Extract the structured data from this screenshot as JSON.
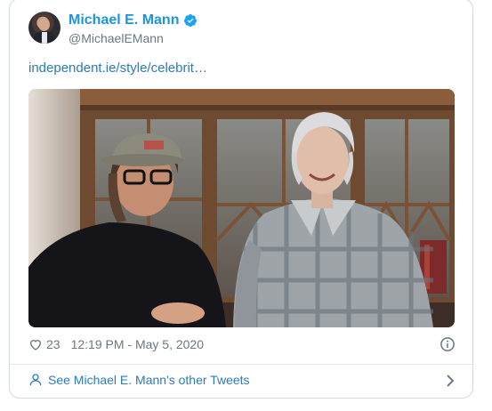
{
  "author": {
    "display_name": "Michael E. Mann",
    "handle": "@MichaelEMann",
    "verified": true
  },
  "tweet": {
    "link_text": "independent.ie/style/celebrit…",
    "likes": "23",
    "timestamp": "12:19 PM - May 5, 2020"
  },
  "footer": {
    "see_more": "See Michael E. Mann's other Tweets"
  },
  "colors": {
    "accent": "#1b95e0",
    "link": "#2b7bb9",
    "muted": "#697882",
    "border": "#cfd9de"
  },
  "icons": {
    "verified": "verified-badge-icon",
    "like": "heart-icon",
    "info": "info-icon",
    "profile": "person-icon",
    "next": "chevron-right-icon"
  }
}
